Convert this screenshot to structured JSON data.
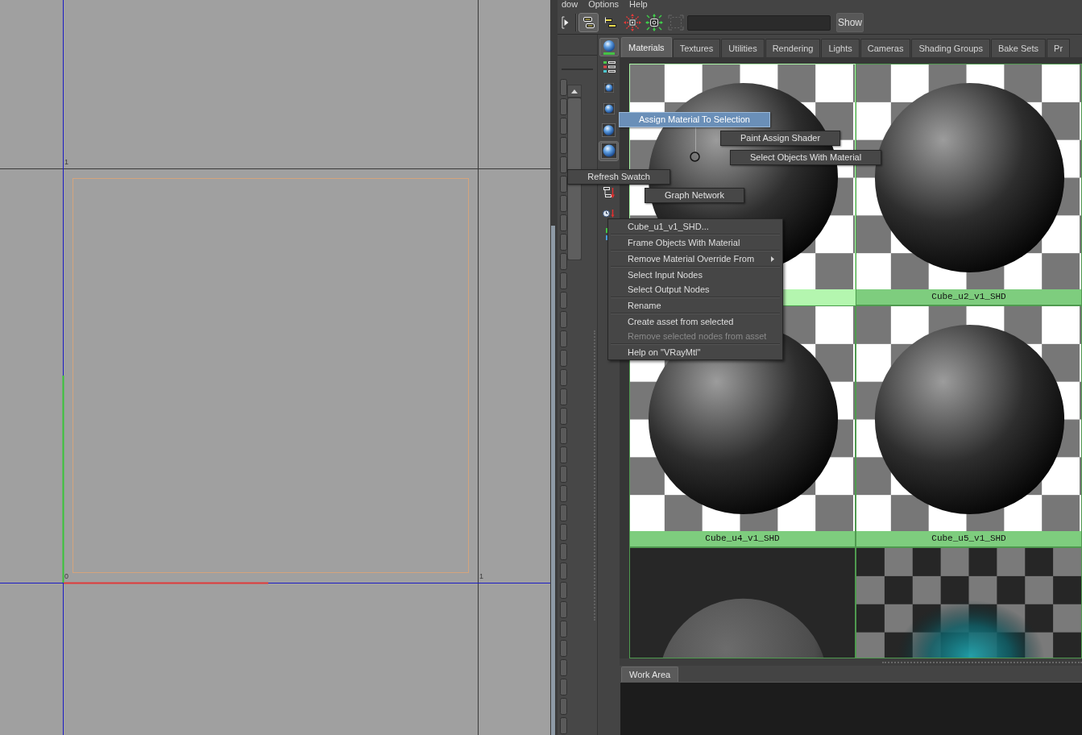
{
  "viewport": {
    "grid_labels": [
      "1",
      "0",
      "1"
    ]
  },
  "menu_bar": [
    "dow",
    "Options",
    "Help"
  ],
  "toolbar": {
    "icons": [
      {
        "kind": "arrow-bracket",
        "selected": false,
        "disabled": false
      },
      {
        "kind": "node-boxes",
        "selected": true,
        "disabled": false
      },
      {
        "kind": "offset-bars",
        "selected": false,
        "disabled": false
      },
      {
        "kind": "expand-arrows",
        "selected": false,
        "disabled": false
      },
      {
        "kind": "frame-arrows",
        "selected": false,
        "disabled": false
      },
      {
        "kind": "dashed-frame",
        "selected": false,
        "disabled": true
      }
    ],
    "show_button": "Show"
  },
  "swatch_sizes": [
    {
      "selected": false
    },
    {
      "selected": false
    },
    {
      "selected": false
    },
    {
      "selected": true
    }
  ],
  "tabs": [
    {
      "label": "Materials",
      "selected": true
    },
    {
      "label": "Textures",
      "selected": false
    },
    {
      "label": "Utilities",
      "selected": false
    },
    {
      "label": "Rendering",
      "selected": false
    },
    {
      "label": "Lights",
      "selected": false
    },
    {
      "label": "Cameras",
      "selected": false
    },
    {
      "label": "Shading Groups",
      "selected": false
    },
    {
      "label": "Bake Sets",
      "selected": false
    },
    {
      "label": "Pr",
      "selected": false
    }
  ],
  "swatches": [
    {
      "kind": "checker-sphere",
      "selected": true
    },
    {
      "kind": "checker-sphere",
      "label": "Cube_u2_v1_SHD",
      "selected": false
    },
    {
      "kind": "checker-sphere",
      "label": "Cube_u4_v1_SHD",
      "selected": false
    },
    {
      "kind": "checker-sphere",
      "label": "Cube_u5_v1_SHD",
      "selected": false
    },
    {
      "kind": "dark-sphere",
      "selected": false
    },
    {
      "kind": "checker-glow",
      "selected": false
    }
  ],
  "work_area_tabs": [
    {
      "label": "Work Area",
      "selected": true
    }
  ],
  "marking_menu": [
    {
      "label": "Assign Material To Selection",
      "selected": true
    },
    {
      "label": "Paint Assign Shader",
      "selected": false
    },
    {
      "label": "Select Objects With Material",
      "selected": false
    },
    {
      "label": "Refresh Swatch",
      "selected": false
    },
    {
      "label": "Graph Network",
      "selected": false
    }
  ],
  "context_menu": [
    [
      {
        "label": "Cube_u1_v1_SHD...",
        "disabled": false,
        "submenu": false
      }
    ],
    [
      {
        "label": "Frame Objects With Material",
        "disabled": false,
        "submenu": false
      }
    ],
    [
      {
        "label": "Remove Material Override From",
        "disabled": false,
        "submenu": true
      }
    ],
    [
      {
        "label": "Select Input Nodes",
        "disabled": false,
        "submenu": false
      },
      {
        "label": "Select Output Nodes",
        "disabled": false,
        "submenu": false
      }
    ],
    [
      {
        "label": "Rename",
        "disabled": false,
        "submenu": false
      }
    ],
    [
      {
        "label": "Create asset from selected",
        "disabled": false,
        "submenu": false
      },
      {
        "label": "Remove selected nodes from asset",
        "disabled": true,
        "submenu": false
      }
    ],
    [
      {
        "label": "Help on \"VRayMtl\"",
        "disabled": false,
        "submenu": false
      }
    ]
  ]
}
